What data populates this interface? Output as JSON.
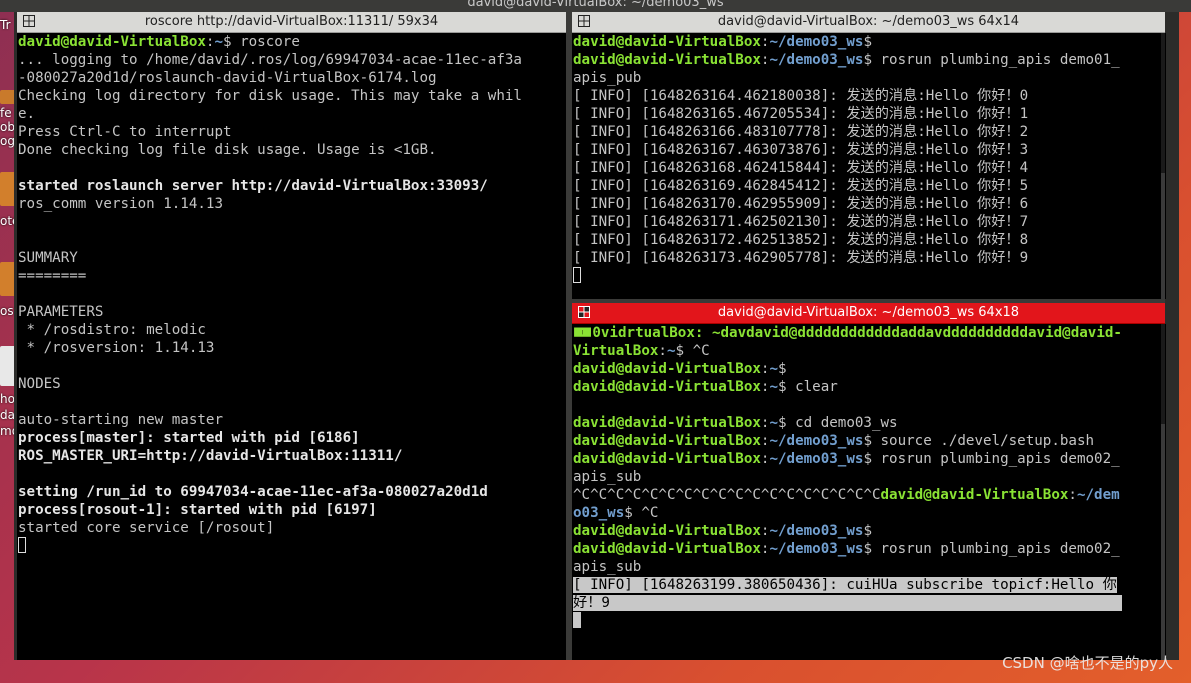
{
  "window_title": "david@david-VirtualBox: ~/demo03_ws",
  "desktop": {
    "labels": [
      "Tr",
      "fe",
      "obo",
      "og",
      "ote",
      "os",
      "ho",
      "da",
      "mo"
    ]
  },
  "left_pane": {
    "title": "roscore http://david-VirtualBox:11311/ 59x34",
    "lines": [
      [
        {
          "t": "david@david-VirtualBox",
          "c": "g"
        },
        {
          "t": ":"
        },
        {
          "t": "~",
          "c": "b"
        },
        {
          "t": "$ roscore"
        }
      ],
      [
        {
          "t": "... logging to /home/david/.ros/log/69947034-acae-11ec-af3a"
        }
      ],
      [
        {
          "t": "-080027a20d1d/roslaunch-david-VirtualBox-6174.log"
        }
      ],
      [
        {
          "t": "Checking log directory for disk usage. This may take a whil"
        }
      ],
      [
        {
          "t": "e."
        }
      ],
      [
        {
          "t": "Press Ctrl-C to interrupt"
        }
      ],
      [
        {
          "t": "Done checking log file disk usage. Usage is <1GB."
        }
      ],
      [
        {
          "t": ""
        }
      ],
      [
        {
          "t": "started roslaunch server http://david-VirtualBox:33093/",
          "c": "w"
        }
      ],
      [
        {
          "t": "ros_comm version 1.14.13"
        }
      ],
      [
        {
          "t": ""
        }
      ],
      [
        {
          "t": ""
        }
      ],
      [
        {
          "t": "SUMMARY"
        }
      ],
      [
        {
          "t": "========"
        }
      ],
      [
        {
          "t": ""
        }
      ],
      [
        {
          "t": "PARAMETERS"
        }
      ],
      [
        {
          "t": " * /rosdistro: melodic"
        }
      ],
      [
        {
          "t": " * /rosversion: 1.14.13"
        }
      ],
      [
        {
          "t": ""
        }
      ],
      [
        {
          "t": "NODES"
        }
      ],
      [
        {
          "t": ""
        }
      ],
      [
        {
          "t": "auto-starting new master"
        }
      ],
      [
        {
          "t": "process[master]: started with pid [6186]",
          "c": "w"
        }
      ],
      [
        {
          "t": "ROS_MASTER_URI=http://david-VirtualBox:11311/",
          "c": "w"
        }
      ],
      [
        {
          "t": ""
        }
      ],
      [
        {
          "t": "setting /run_id to 69947034-acae-11ec-af3a-080027a20d1d",
          "c": "w"
        }
      ],
      [
        {
          "t": "process[rosout-1]: started with pid [6197]",
          "c": "w"
        }
      ],
      [
        {
          "t": "started core service [/rosout]"
        }
      ],
      [
        {
          "t": "",
          "cursor": "hollow"
        }
      ]
    ]
  },
  "top_right_pane": {
    "title": "david@david-VirtualBox: ~/demo03_ws 64x14",
    "lines": [
      [
        {
          "t": "david@david-VirtualBox",
          "c": "g"
        },
        {
          "t": ":"
        },
        {
          "t": "~/demo03_ws",
          "c": "b"
        },
        {
          "t": "$"
        }
      ],
      [
        {
          "t": "david@david-VirtualBox",
          "c": "g"
        },
        {
          "t": ":"
        },
        {
          "t": "~/demo03_ws",
          "c": "b"
        },
        {
          "t": "$ rosrun plumbing_apis demo01_"
        }
      ],
      [
        {
          "t": "apis_pub"
        }
      ],
      [
        {
          "t": "[ INFO] [1648263164.462180038]: 发送的消息:Hello 你好！0"
        }
      ],
      [
        {
          "t": "[ INFO] [1648263165.467205534]: 发送的消息:Hello 你好！1"
        }
      ],
      [
        {
          "t": "[ INFO] [1648263166.483107778]: 发送的消息:Hello 你好！2"
        }
      ],
      [
        {
          "t": "[ INFO] [1648263167.463073876]: 发送的消息:Hello 你好！3"
        }
      ],
      [
        {
          "t": "[ INFO] [1648263168.462415844]: 发送的消息:Hello 你好！4"
        }
      ],
      [
        {
          "t": "[ INFO] [1648263169.462845412]: 发送的消息:Hello 你好！5"
        }
      ],
      [
        {
          "t": "[ INFO] [1648263170.462955909]: 发送的消息:Hello 你好！6"
        }
      ],
      [
        {
          "t": "[ INFO] [1648263171.462502130]: 发送的消息:Hello 你好！7"
        }
      ],
      [
        {
          "t": "[ INFO] [1648263172.462513852]: 发送的消息:Hello 你好！8"
        }
      ],
      [
        {
          "t": "[ INFO] [1648263173.462905778]: 发送的消息:Hello 你好！9"
        }
      ],
      [
        {
          "t": "",
          "cursor": "hollow"
        }
      ]
    ]
  },
  "bottom_right_pane": {
    "title": "david@david-VirtualBox: ~/demo03_ws 64x18",
    "lines": [
      [
        {
          "t": "🀰",
          "c": "g"
        },
        {
          "t": "0vidrtualBox: ~davdavid@ddddddddddddaddavddddddddddavid@david-",
          "c": "g"
        }
      ],
      [
        {
          "t": "VirtualBox",
          "c": "g"
        },
        {
          "t": ":"
        },
        {
          "t": "~",
          "c": "b"
        },
        {
          "t": "$ ^C"
        }
      ],
      [
        {
          "t": "david@david-VirtualBox",
          "c": "g"
        },
        {
          "t": ":"
        },
        {
          "t": "~",
          "c": "b"
        },
        {
          "t": "$"
        }
      ],
      [
        {
          "t": "david@david-VirtualBox",
          "c": "g"
        },
        {
          "t": ":"
        },
        {
          "t": "~",
          "c": "b"
        },
        {
          "t": "$ clear"
        }
      ],
      [
        {
          "t": ""
        }
      ],
      [
        {
          "t": "david@david-VirtualBox",
          "c": "g"
        },
        {
          "t": ":"
        },
        {
          "t": "~",
          "c": "b"
        },
        {
          "t": "$ cd demo03_ws"
        }
      ],
      [
        {
          "t": "david@david-VirtualBox",
          "c": "g"
        },
        {
          "t": ":"
        },
        {
          "t": "~/demo03_ws",
          "c": "b"
        },
        {
          "t": "$ source ./devel/setup.bash"
        }
      ],
      [
        {
          "t": "david@david-VirtualBox",
          "c": "g"
        },
        {
          "t": ":"
        },
        {
          "t": "~/demo03_ws",
          "c": "b"
        },
        {
          "t": "$ rosrun plumbing_apis demo02_"
        }
      ],
      [
        {
          "t": "apis_sub"
        }
      ],
      [
        {
          "t": "^C^C^C^C^C^C^C^C^C^C^C^C^C^C^C^C^C^C"
        },
        {
          "t": "david@david-VirtualBox",
          "c": "g"
        },
        {
          "t": ":"
        },
        {
          "t": "~/dem",
          "c": "b"
        }
      ],
      [
        {
          "t": "o03_ws",
          "c": "b"
        },
        {
          "t": "$ ^C"
        }
      ],
      [
        {
          "t": "david@david-VirtualBox",
          "c": "g"
        },
        {
          "t": ":"
        },
        {
          "t": "~/demo03_ws",
          "c": "b"
        },
        {
          "t": "$"
        }
      ],
      [
        {
          "t": "david@david-VirtualBox",
          "c": "g"
        },
        {
          "t": ":"
        },
        {
          "t": "~/demo03_ws",
          "c": "b"
        },
        {
          "t": "$ rosrun plumbing_apis demo02_"
        }
      ],
      [
        {
          "t": "apis_sub"
        }
      ],
      [
        {
          "t": "[ INFO] [1648263199.380650436]: cuiHUa subscribe topicf:Hello 你",
          "c": "sel"
        }
      ],
      [
        {
          "t": "好！9",
          "c": "sel"
        },
        {
          "t": "                                                            ",
          "c": "sel"
        }
      ],
      [
        {
          "t": "",
          "cursor": "block"
        }
      ]
    ]
  },
  "watermark": "CSDN @啥也不是的py人"
}
